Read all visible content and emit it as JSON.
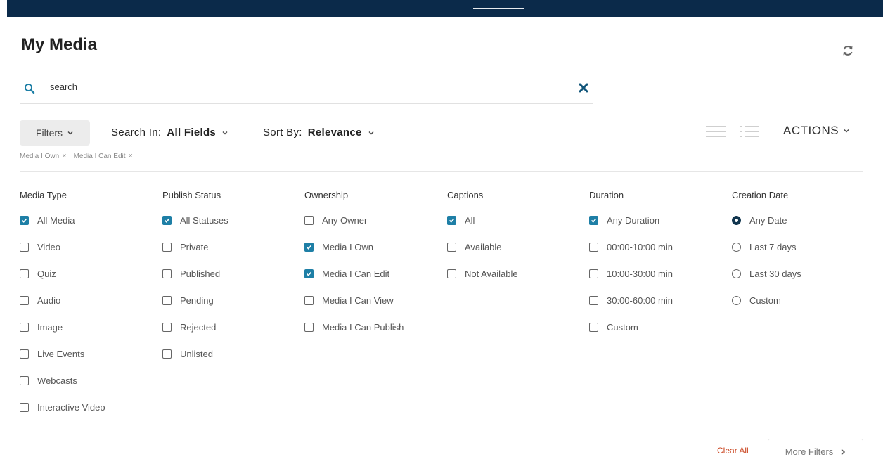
{
  "page": {
    "title": "My Media"
  },
  "search": {
    "value": "search"
  },
  "toolbar": {
    "filters_label": "Filters",
    "search_in_prefix": "Search In:",
    "search_in_value": "All Fields",
    "sort_by_prefix": "Sort By:",
    "sort_by_value": "Relevance",
    "actions_label": "ACTIONS"
  },
  "active_filters": [
    {
      "label": "Media I Own"
    },
    {
      "label": "Media I Can Edit"
    }
  ],
  "filter_groups": [
    {
      "title": "Media Type",
      "kind": "checkbox",
      "options": [
        {
          "label": "All Media",
          "checked": true
        },
        {
          "label": "Video",
          "checked": false
        },
        {
          "label": "Quiz",
          "checked": false
        },
        {
          "label": "Audio",
          "checked": false
        },
        {
          "label": "Image",
          "checked": false
        },
        {
          "label": "Live Events",
          "checked": false
        },
        {
          "label": "Webcasts",
          "checked": false
        },
        {
          "label": "Interactive Video",
          "checked": false
        }
      ]
    },
    {
      "title": "Publish Status",
      "kind": "checkbox",
      "options": [
        {
          "label": "All Statuses",
          "checked": true
        },
        {
          "label": "Private",
          "checked": false
        },
        {
          "label": "Published",
          "checked": false
        },
        {
          "label": "Pending",
          "checked": false
        },
        {
          "label": "Rejected",
          "checked": false
        },
        {
          "label": "Unlisted",
          "checked": false
        }
      ]
    },
    {
      "title": "Ownership",
      "kind": "checkbox",
      "options": [
        {
          "label": "Any Owner",
          "checked": false
        },
        {
          "label": "Media I Own",
          "checked": true
        },
        {
          "label": "Media I Can Edit",
          "checked": true
        },
        {
          "label": "Media I Can View",
          "checked": false
        },
        {
          "label": "Media I Can Publish",
          "checked": false
        }
      ]
    },
    {
      "title": "Captions",
      "kind": "checkbox",
      "options": [
        {
          "label": "All",
          "checked": true
        },
        {
          "label": "Available",
          "checked": false
        },
        {
          "label": "Not Available",
          "checked": false
        }
      ]
    },
    {
      "title": "Duration",
      "kind": "checkbox",
      "options": [
        {
          "label": "Any Duration",
          "checked": true
        },
        {
          "label": "00:00-10:00 min",
          "checked": false
        },
        {
          "label": "10:00-30:00 min",
          "checked": false
        },
        {
          "label": "30:00-60:00 min",
          "checked": false
        },
        {
          "label": "Custom",
          "checked": false
        }
      ]
    },
    {
      "title": "Creation Date",
      "kind": "radio",
      "options": [
        {
          "label": "Any Date",
          "checked": true
        },
        {
          "label": "Last 7 days",
          "checked": false
        },
        {
          "label": "Last 30 days",
          "checked": false
        },
        {
          "label": "Custom",
          "checked": false
        }
      ]
    }
  ],
  "footer": {
    "clear_all_label": "Clear All",
    "more_filters_label": "More Filters"
  },
  "colors": {
    "topbar": "#0b2a4a",
    "accent": "#1e7fa6",
    "clear_all": "#c9401a"
  },
  "icons": [
    "refresh-icon",
    "search-icon",
    "clear-search-icon",
    "chevron-down-icon",
    "list-view-icon",
    "detailed-list-view-icon",
    "close-icon",
    "chevron-right-icon"
  ]
}
